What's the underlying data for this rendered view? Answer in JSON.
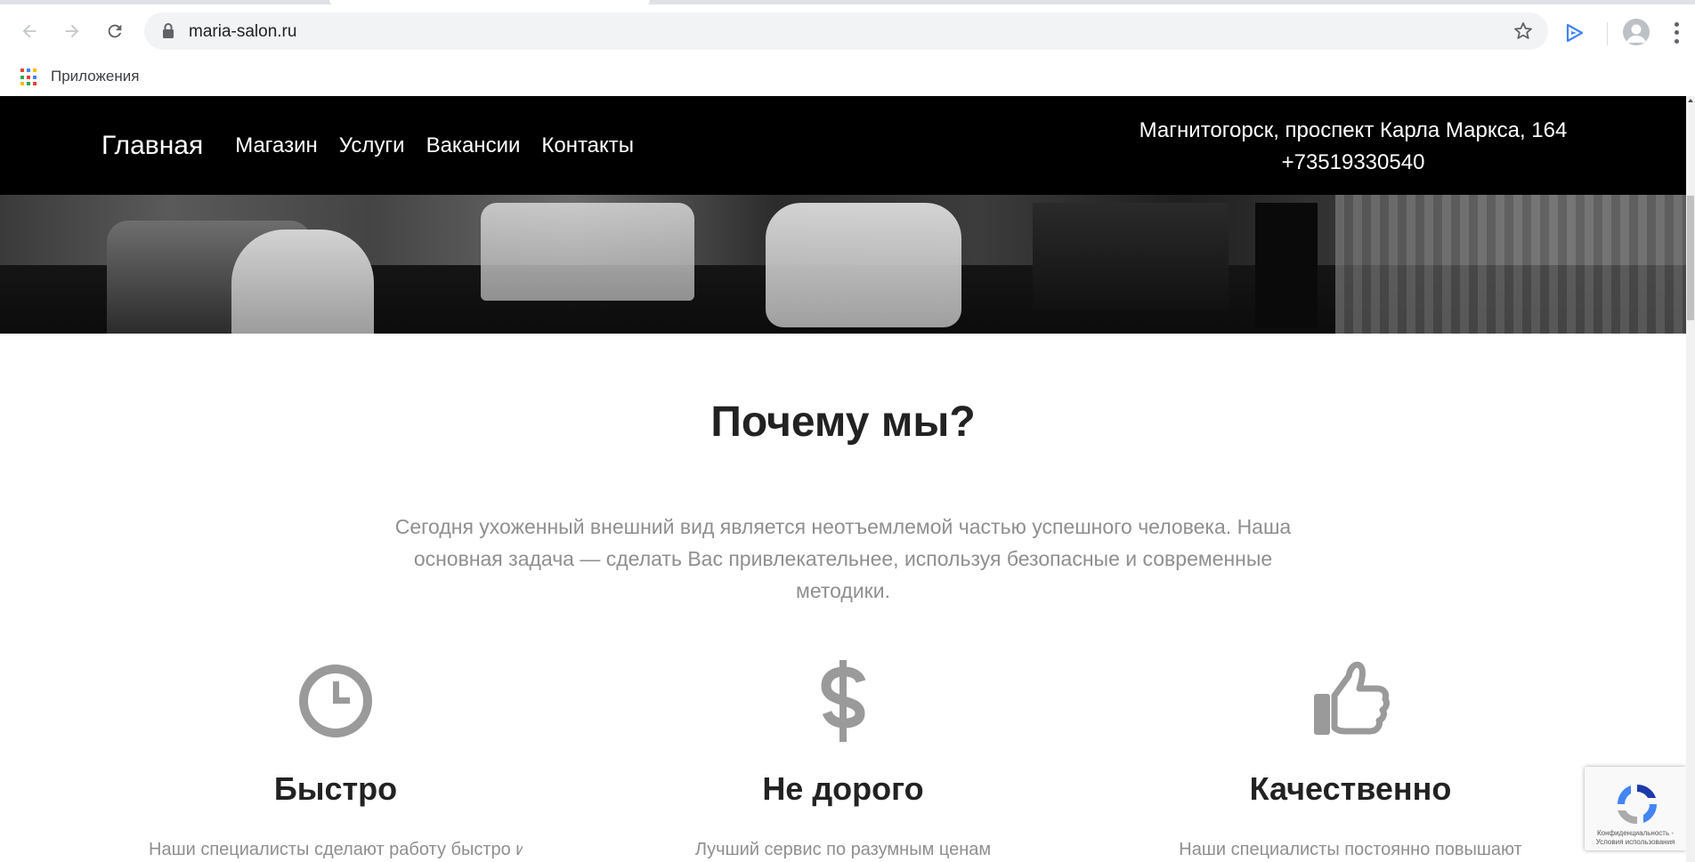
{
  "browser": {
    "url": "maria-salon.ru",
    "bookmarks_apps_label": "Приложения"
  },
  "header": {
    "nav": [
      {
        "label": "Главная"
      },
      {
        "label": "Магазин"
      },
      {
        "label": "Услуги"
      },
      {
        "label": "Вакансии"
      },
      {
        "label": "Контакты"
      }
    ],
    "address": "Магнитогорск, проспект Карла Маркса, 164",
    "phone": "+73519330540"
  },
  "why_us": {
    "title": "Почему мы?",
    "text": "Сегодня ухоженный внешний вид является неотъемлемой частью успешного человека. Наша основная задача — сделать Вас привлекательнее, используя безопасные и современные методики.",
    "features": [
      {
        "icon": "clock-icon",
        "title": "Быстро",
        "desc": "Наши специалисты сделают работу быстро и"
      },
      {
        "icon": "dollar-icon",
        "title": "Не дорого",
        "desc": "Лучший сервис по разумным ценам"
      },
      {
        "icon": "thumbs-up-icon",
        "title": "Качественно",
        "desc": "Наши специалисты постоянно повышают"
      }
    ]
  },
  "recaptcha": {
    "legal": "Конфиденциальность - Условия использования"
  },
  "colors": {
    "header_bg": "#000000",
    "icon_gray": "#9a9a9a",
    "text_gray": "#8f8f8f",
    "heading": "#222222"
  }
}
